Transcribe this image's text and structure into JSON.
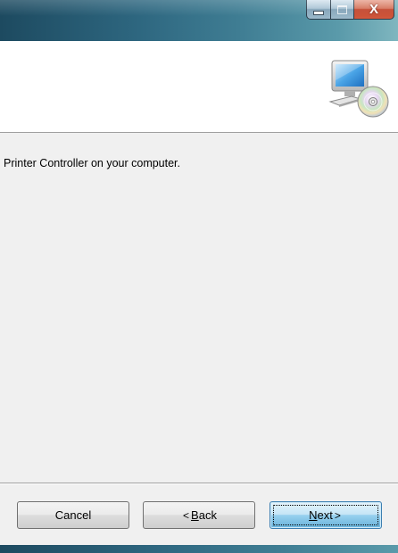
{
  "titlebar": {
    "close_label": "X"
  },
  "content": {
    "description": "Printer Controller on your computer."
  },
  "buttons": {
    "cancel": "Cancel",
    "back_chevron": "<",
    "back_accel": "B",
    "back_rest": "ack",
    "next_accel": "N",
    "next_rest": "ext",
    "next_chevron": ">"
  },
  "colors": {
    "titlebar": "#2e6780",
    "close": "#c1432a",
    "panel": "#f0f0f0",
    "default_button": "#98d1ef"
  },
  "icons": {
    "header": "computer-with-cd-icon"
  }
}
